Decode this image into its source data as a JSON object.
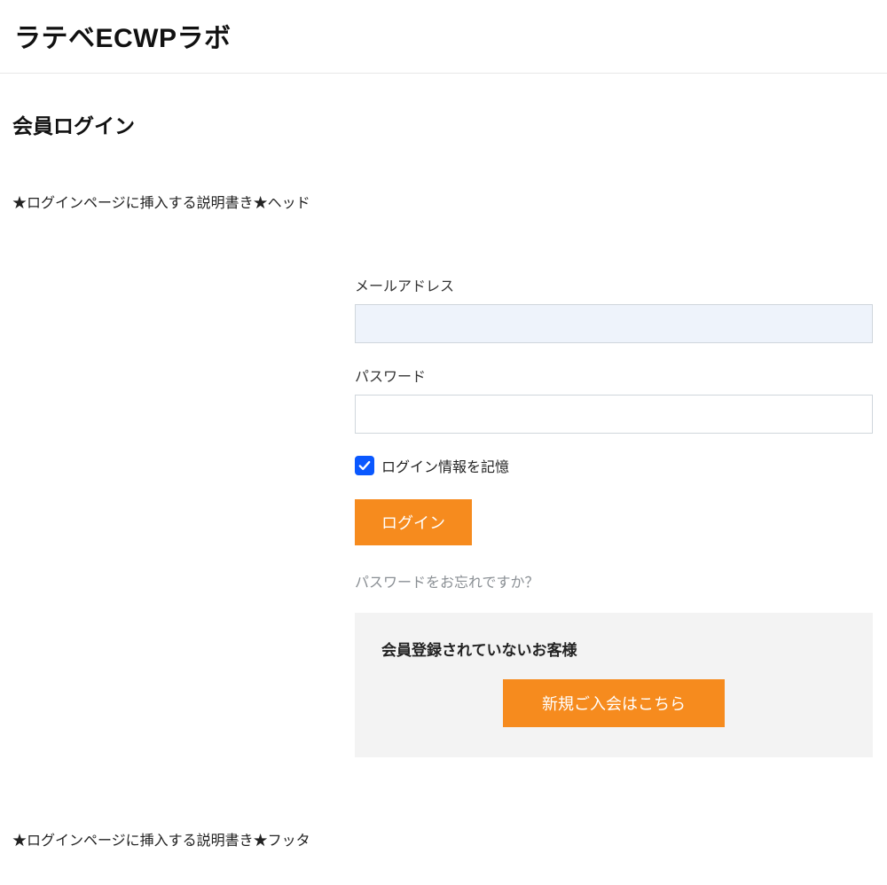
{
  "site": {
    "title": "ラテベECWPラボ"
  },
  "page": {
    "title": "会員ログイン",
    "head_description": "★ログインページに挿入する説明書き★ヘッド",
    "foot_description": "★ログインページに挿入する説明書き★フッタ"
  },
  "form": {
    "email_label": "メールアドレス",
    "email_value": "",
    "password_label": "パスワード",
    "password_value": "",
    "remember_label": "ログイン情報を記憶",
    "remember_checked": true,
    "login_button": "ログイン",
    "forgot_link": "パスワードをお忘れですか？"
  },
  "register": {
    "title": "会員登録されていないお客様",
    "button": "新規ご入会はこちら"
  },
  "colors": {
    "accent": "#f68b1e",
    "checkbox": "#0a58ff",
    "panel_bg": "#f3f3f3"
  }
}
